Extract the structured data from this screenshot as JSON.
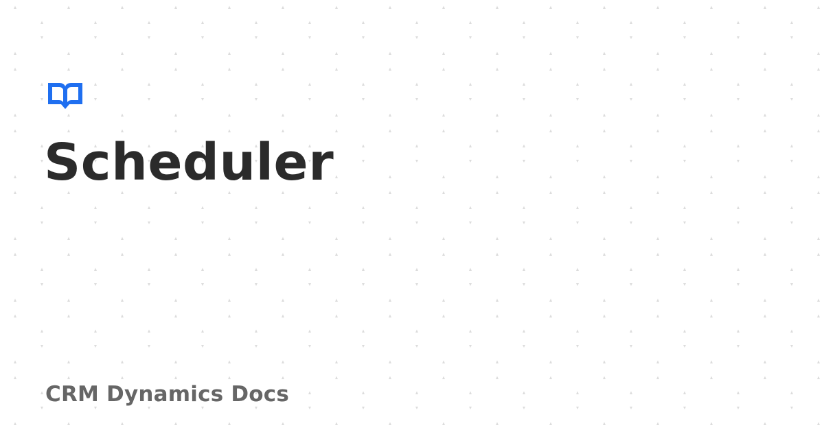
{
  "page": {
    "title": "Scheduler",
    "site_name": "CRM Dynamics Docs"
  },
  "icons": {
    "logo": "open-book-icon"
  },
  "colors": {
    "background": "#ffffff",
    "pattern_dot": "#dcdcdc",
    "accent": "#1f6ff0",
    "title_text": "#2b2b2b",
    "site_name_text": "#666666"
  }
}
